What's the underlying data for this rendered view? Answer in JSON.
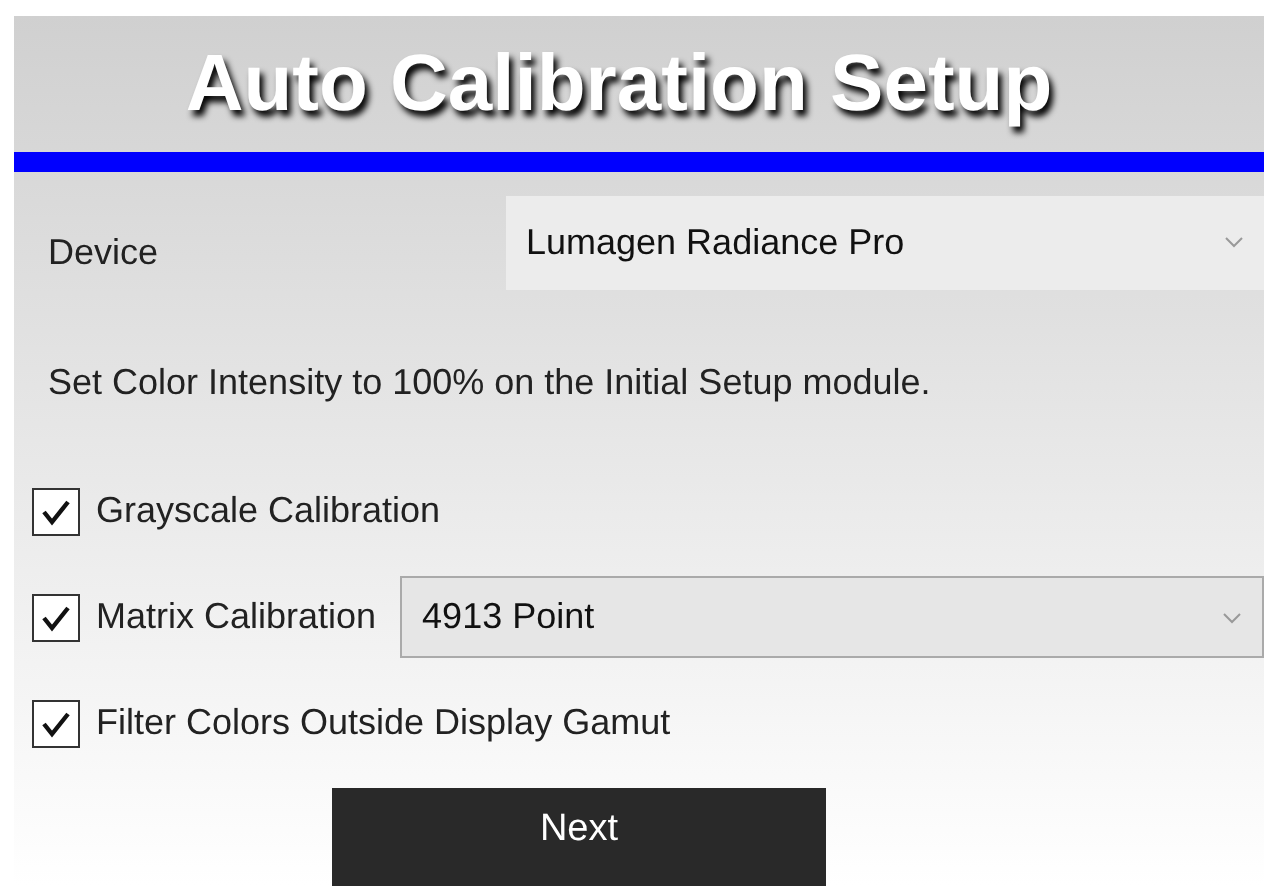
{
  "title": "Auto Calibration Setup",
  "device": {
    "label": "Device",
    "value": "Lumagen Radiance Pro"
  },
  "instruction": "Set Color Intensity to 100% on the Initial Setup module.",
  "options": [
    {
      "kind": "check",
      "label": "Grayscale Calibration",
      "checked": true
    },
    {
      "kind": "check-select",
      "label": "Matrix Calibration",
      "checked": true,
      "value": "4913 Point"
    },
    {
      "kind": "check",
      "label": "Filter Colors Outside Display Gamut",
      "checked": true
    }
  ],
  "button": "Next"
}
